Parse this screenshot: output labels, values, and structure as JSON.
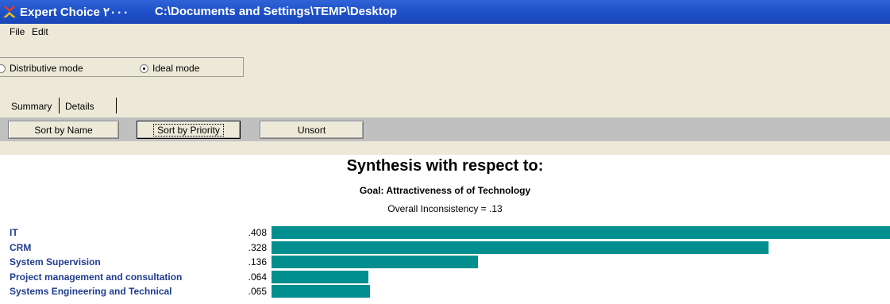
{
  "window": {
    "app_name": "Expert Choice ۲۰۰۰",
    "doc_path": "C:\\Documents and Settings\\TEMP\\Desktop"
  },
  "menu": {
    "items": [
      "File",
      "Edit"
    ]
  },
  "mode": {
    "distributive_label": "Distributive mode",
    "ideal_label": "Ideal mode",
    "selected": "Ideal mode"
  },
  "tabs": {
    "summary_label": "Summary",
    "details_label": "Details",
    "active": "Summary"
  },
  "buttons": {
    "sort_name": "Sort by Name",
    "sort_priority": "Sort by Priority",
    "unsort": "Unsort"
  },
  "synthesis": {
    "title": "Synthesis with respect to:",
    "goal": "Goal: Attractiveness of of Technology",
    "inconsistency": "Overall Inconsistency = .13"
  },
  "colors": {
    "bar": "#008e8e",
    "name_text": "#1f3c8f",
    "titlebar": "#1d4fc7"
  },
  "chart_data": {
    "type": "bar",
    "orientation": "horizontal",
    "categories": [
      "IT",
      "CRM",
      "System Supervision",
      "Project management and consultation",
      "Systems Engineering and Technical"
    ],
    "values": [
      0.408,
      0.328,
      0.136,
      0.064,
      0.065
    ],
    "labels": [
      ".408",
      ".328",
      ".136",
      ".064",
      ".065"
    ],
    "xlim": [
      0,
      0.408
    ],
    "grid": false
  }
}
